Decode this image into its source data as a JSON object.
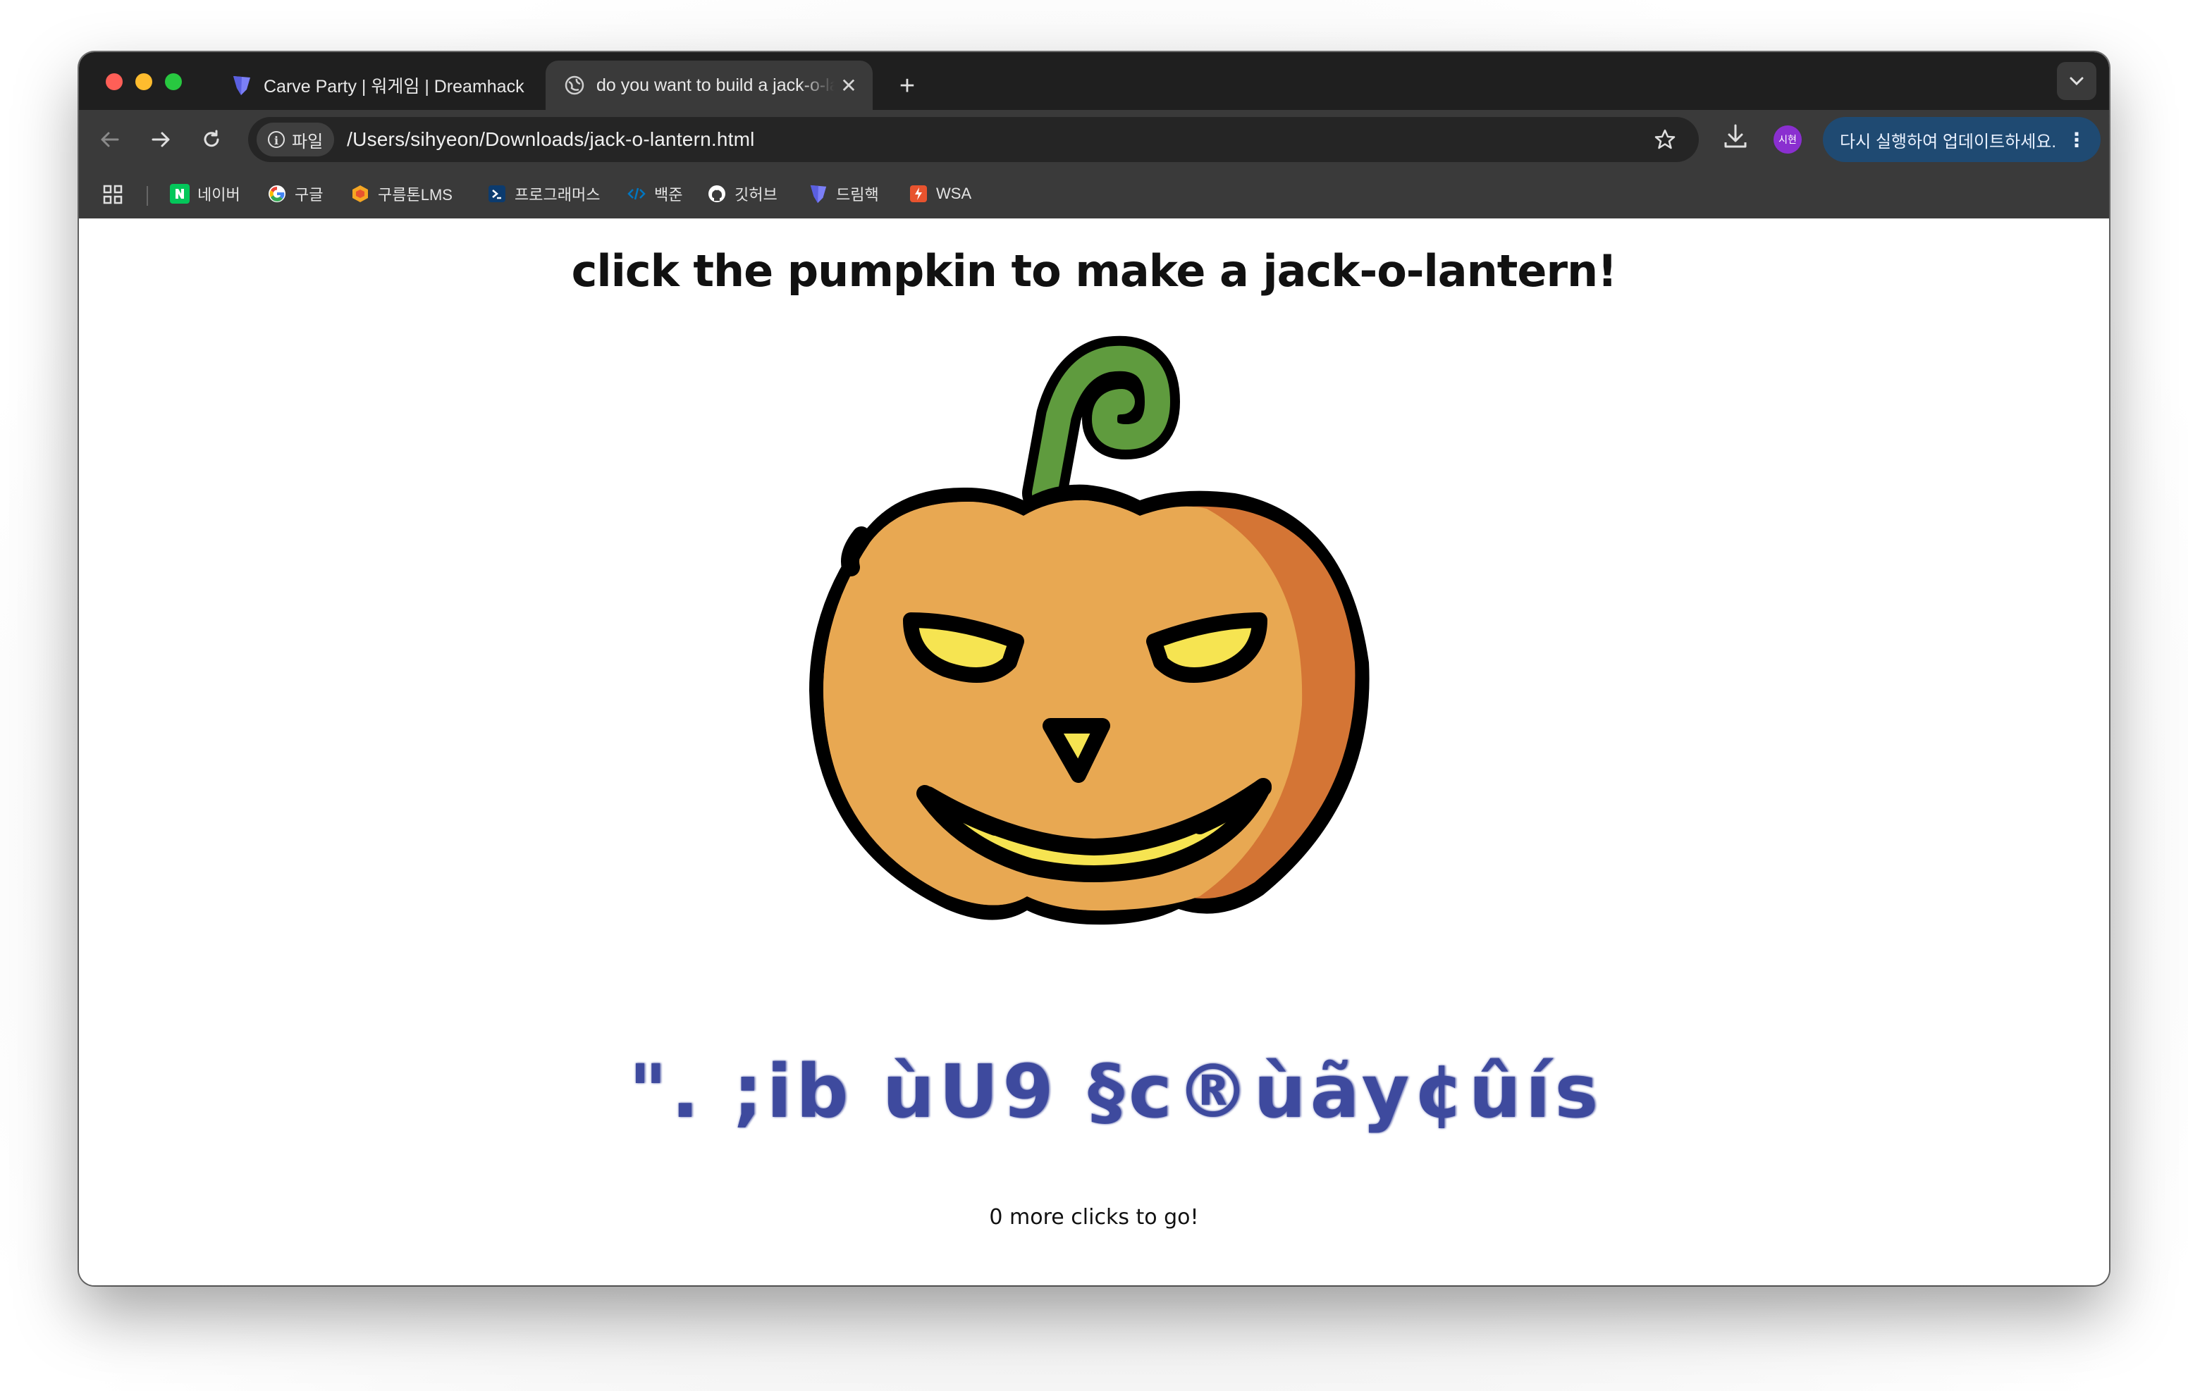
{
  "browser": {
    "tabs": [
      {
        "title": "Carve Party | 워게임 | Dreamhack",
        "active": false,
        "favicon": "dreamhack-shield-icon"
      },
      {
        "title": "do you want to build a jack-o-lantern?",
        "active": true,
        "favicon": "globe-icon"
      }
    ],
    "new_tab_symbol": "+",
    "close_symbol": "✕",
    "address": {
      "chip_label": "파일",
      "url": "/Users/sihyeon/Downloads/jack-o-lantern.html"
    },
    "profile_initials": "시현",
    "update_label": "다시 실행하여 업데이트하세요.",
    "kebab_symbol": "⋮",
    "bookmarks": [
      {
        "label": "네이버",
        "icon": "naver-icon",
        "color": "#03c75a"
      },
      {
        "label": "구글",
        "icon": "google-icon",
        "color": "#4285f4"
      },
      {
        "label": "구름톤LMS",
        "icon": "goorm-icon",
        "color": "#f5a623"
      },
      {
        "label": "프로그래머스",
        "icon": "programmers-icon",
        "color": "#0c3b6e"
      },
      {
        "label": "백준",
        "icon": "baekjoon-icon",
        "color": "#0076c0"
      },
      {
        "label": "깃허브",
        "icon": "github-icon",
        "color": "#ffffff"
      },
      {
        "label": "드림핵",
        "icon": "dreamhack-icon",
        "color": "#6b6ef6"
      },
      {
        "label": "WSA",
        "icon": "wsa-icon",
        "color": "#e8532e"
      }
    ]
  },
  "page": {
    "heading": "click the pumpkin to make a jack-o-lantern!",
    "garbled_text": "\". ;ib ùU9 §c®ùãy¢ûís",
    "counter": "0 more clicks to go!",
    "colors": {
      "pumpkin_body": "#e8a852",
      "pumpkin_shade": "#d47535",
      "stem": "#5f9b3e",
      "eyes": "#f6e451",
      "outline": "#000000",
      "garbled_text": "#3e4a9e"
    }
  }
}
